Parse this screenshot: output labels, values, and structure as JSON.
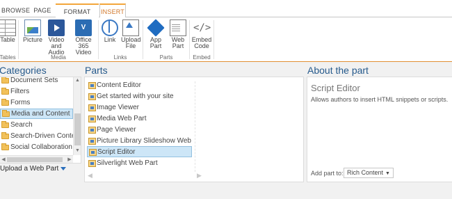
{
  "tabs": [
    {
      "label": "BROWSE"
    },
    {
      "label": "PAGE"
    },
    {
      "label": "FORMAT TEXT"
    },
    {
      "label": "INSERT"
    }
  ],
  "ribbon": {
    "buttons": [
      {
        "label": "Table",
        "icon": "table-icon"
      },
      {
        "label": "Picture",
        "icon": "picture-icon"
      },
      {
        "label": "Video and\nAudio",
        "icon": "video-icon"
      },
      {
        "label": "Office 365\nVideo",
        "icon": "office365-video-icon"
      },
      {
        "label": "Link",
        "icon": "link-icon"
      },
      {
        "label": "Upload\nFile",
        "icon": "upload-file-icon"
      },
      {
        "label": "App\nPart",
        "icon": "app-part-icon"
      },
      {
        "label": "Web\nPart",
        "icon": "web-part-icon"
      },
      {
        "label": "Embed\nCode",
        "icon": "embed-code-icon"
      }
    ],
    "groups": [
      "Tables",
      "Media",
      "Links",
      "Parts",
      "Embed"
    ]
  },
  "categories": {
    "heading": "Categories",
    "items": [
      {
        "label": "Document Sets"
      },
      {
        "label": "Filters"
      },
      {
        "label": "Forms"
      },
      {
        "label": "Media and Content"
      },
      {
        "label": "Search"
      },
      {
        "label": "Search-Driven Content"
      },
      {
        "label": "Social Collaboration"
      }
    ],
    "selected": "Media and Content",
    "upload_label": "Upload a Web Part"
  },
  "parts": {
    "heading": "Parts",
    "items": [
      {
        "label": "Content Editor"
      },
      {
        "label": "Get started with your site"
      },
      {
        "label": "Image Viewer"
      },
      {
        "label": "Media Web Part"
      },
      {
        "label": "Page Viewer"
      },
      {
        "label": "Picture Library Slideshow Web Par"
      },
      {
        "label": "Script Editor"
      },
      {
        "label": "Silverlight Web Part"
      }
    ],
    "selected": "Script Editor"
  },
  "about": {
    "heading": "About the part",
    "title": "Script Editor",
    "description": "Allows authors to insert HTML snippets or scripts.",
    "add_part_label": "Add part to:",
    "add_part_value": "Rich Content"
  },
  "colors": {
    "accent": "#265a8c",
    "context_tab": "#f3a63b",
    "selection": "#cde6f7"
  }
}
